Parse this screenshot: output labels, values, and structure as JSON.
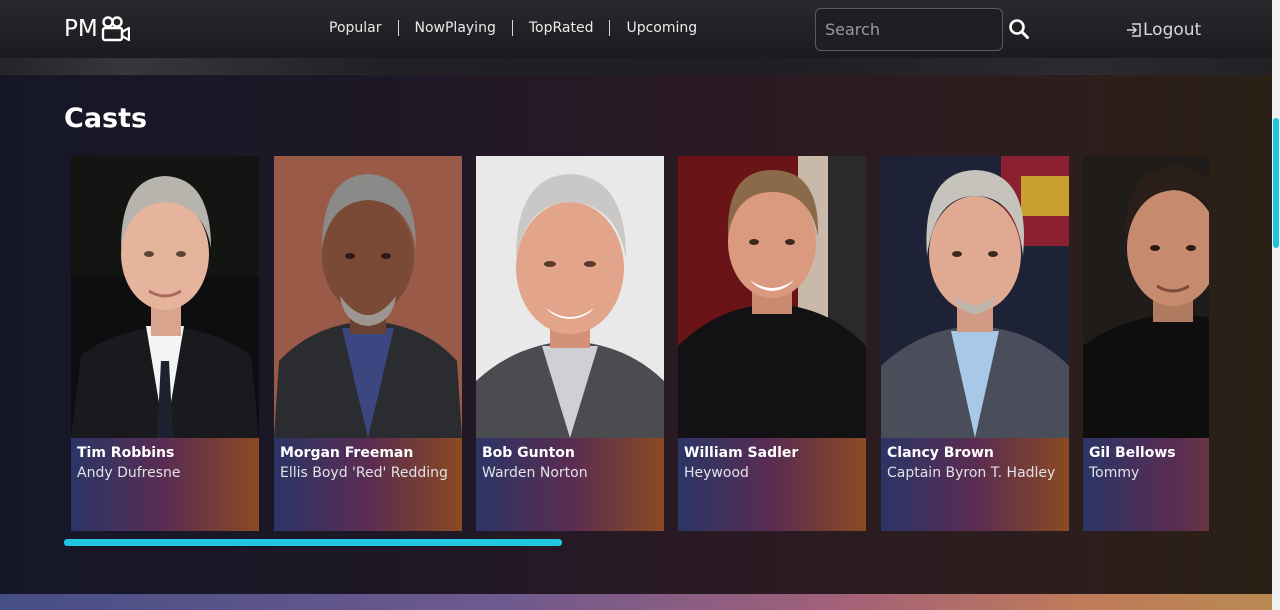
{
  "header": {
    "logo_text": "PM",
    "logo_icon": "movie-camera-icon",
    "nav": [
      {
        "label": "Popular"
      },
      {
        "label": "NowPlaying"
      },
      {
        "label": "TopRated"
      },
      {
        "label": "Upcoming"
      }
    ],
    "search": {
      "placeholder": "Search",
      "value": ""
    },
    "logout_label": "Logout"
  },
  "section": {
    "title": "Casts"
  },
  "casts": [
    {
      "actor": "Tim Robbins",
      "character": "Andy Dufresne"
    },
    {
      "actor": "Morgan Freeman",
      "character": "Ellis Boyd 'Red' Redding"
    },
    {
      "actor": "Bob Gunton",
      "character": "Warden Norton"
    },
    {
      "actor": "William Sadler",
      "character": "Heywood"
    },
    {
      "actor": "Clancy Brown",
      "character": "Captain Byron T. Hadley"
    },
    {
      "actor": "Gil Bellows",
      "character": "Tommy"
    }
  ],
  "colors": {
    "accent": "#21c6e0",
    "card_gradient_start": "#2b3566",
    "card_gradient_mid": "#5a2c52",
    "card_gradient_end": "#8a4a22"
  },
  "carousel": {
    "scroll_fraction": 0.435
  }
}
